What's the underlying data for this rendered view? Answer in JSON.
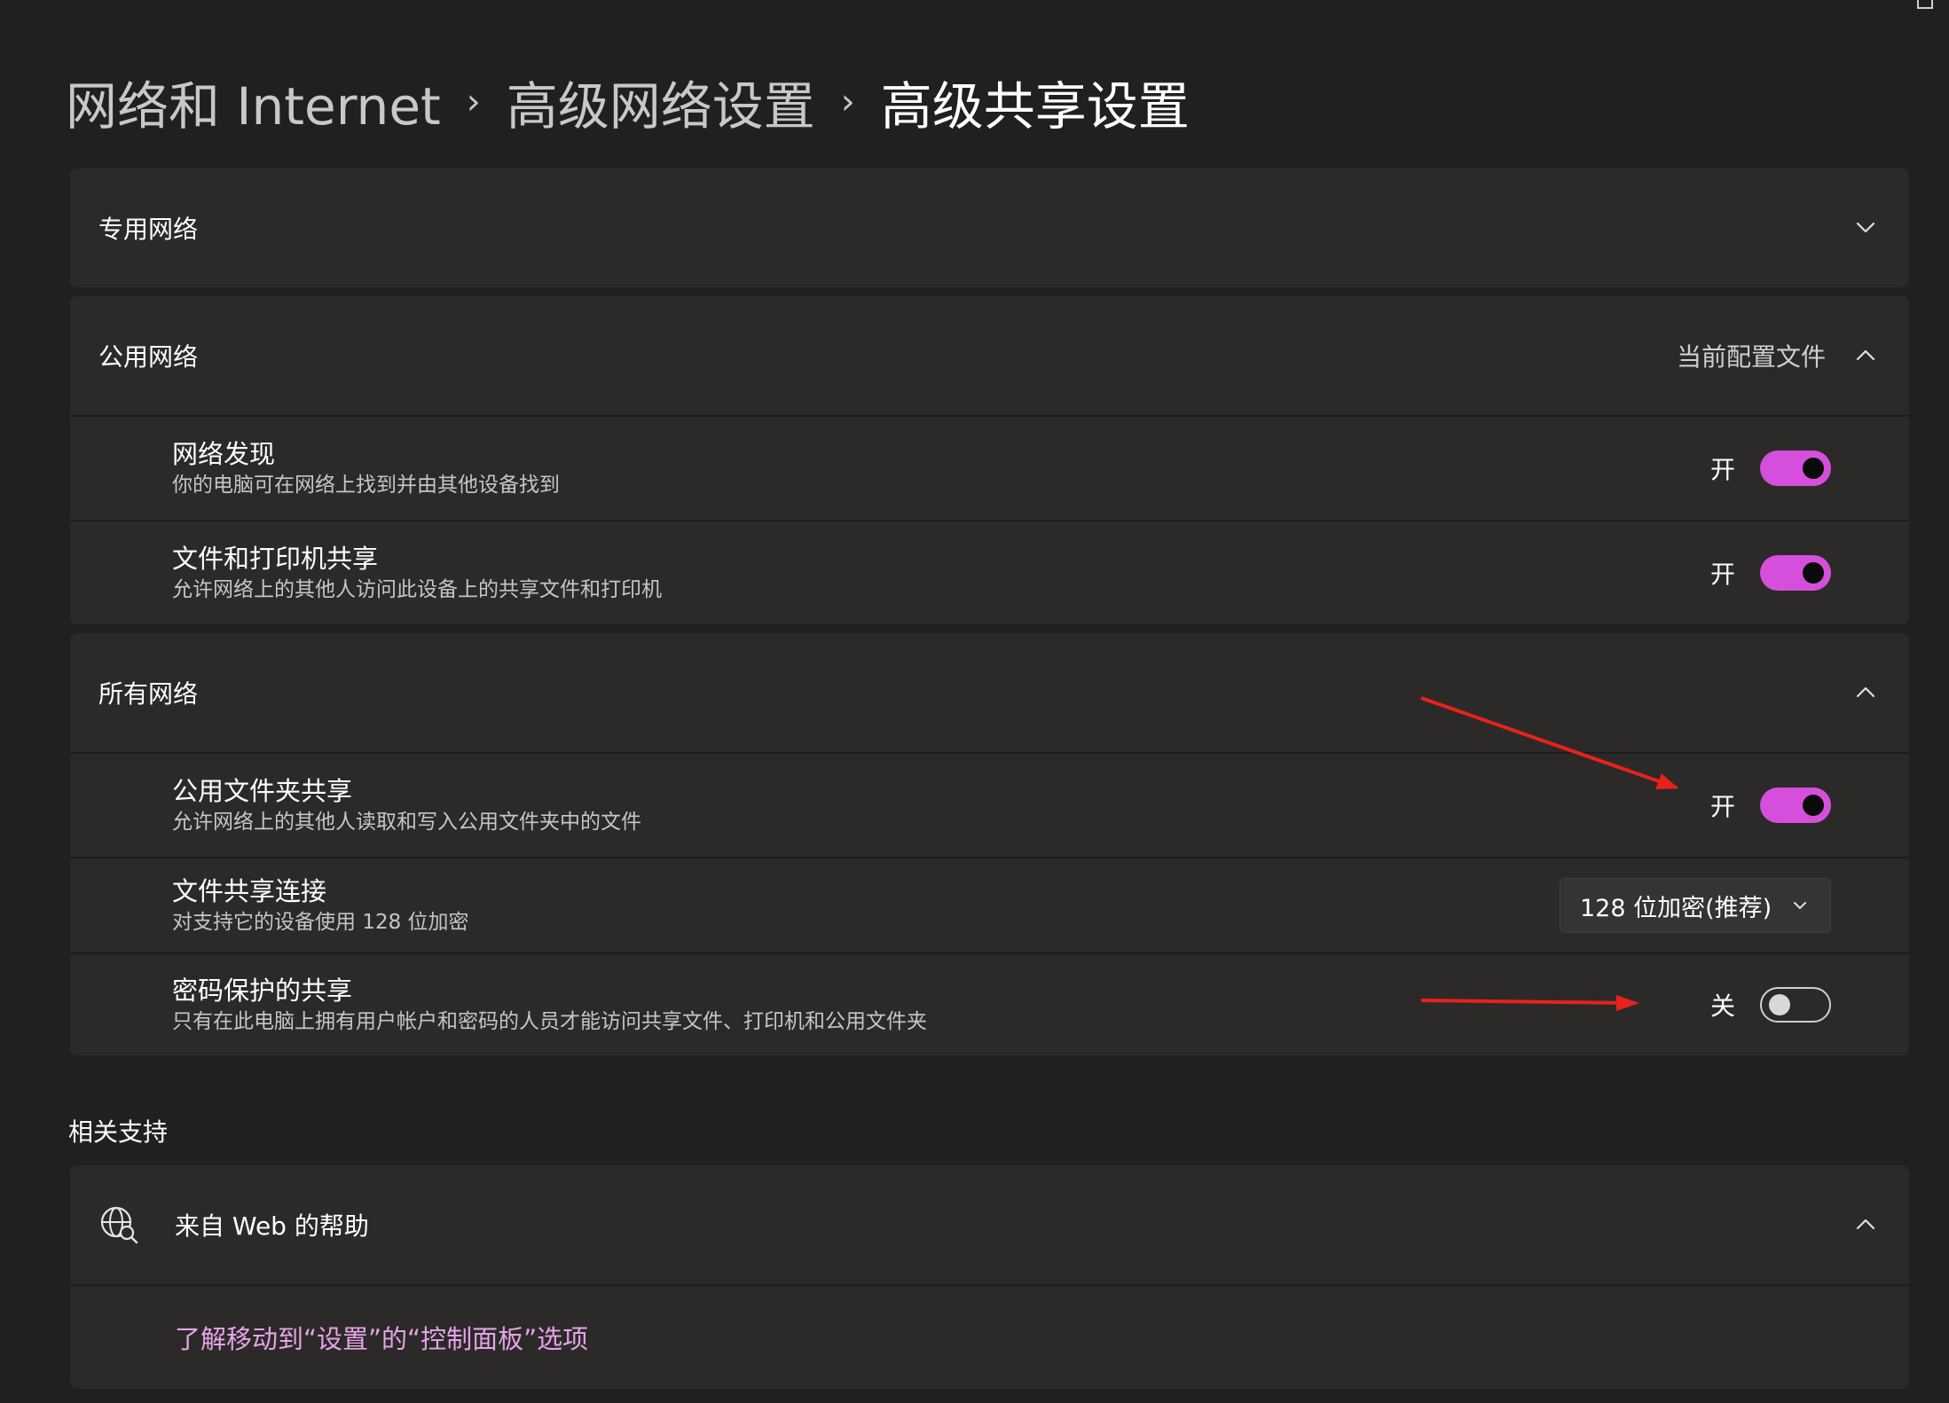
{
  "breadcrumb": {
    "items": [
      "网络和 Internet",
      "高级网络设置",
      "高级共享设置"
    ],
    "separator": "›"
  },
  "private_network": {
    "title": "专用网络",
    "expanded": false
  },
  "public_network": {
    "title": "公用网络",
    "tag": "当前配置文件",
    "expanded": true,
    "rows": [
      {
        "title": "网络发现",
        "description": "你的电脑可在网络上找到并由其他设备找到",
        "state_label": "开",
        "on": true
      },
      {
        "title": "文件和打印机共享",
        "description": "允许网络上的其他人访问此设备上的共享文件和打印机",
        "state_label": "开",
        "on": true
      }
    ]
  },
  "all_networks": {
    "title": "所有网络",
    "expanded": true,
    "public_folder_sharing": {
      "title": "公用文件夹共享",
      "description": "允许网络上的其他人读取和写入公用文件夹中的文件",
      "state_label": "开",
      "on": true
    },
    "file_sharing_connections": {
      "title": "文件共享连接",
      "description": "对支持它的设备使用 128 位加密",
      "selected": "128 位加密(推荐)"
    },
    "password_protected_sharing": {
      "title": "密码保护的共享",
      "description": "只有在此电脑上拥有用户帐户和密码的人员才能访问共享文件、打印机和公用文件夹",
      "state_label": "关",
      "on": false
    }
  },
  "related_support": {
    "label": "相关支持",
    "help_title": "来自 Web 的帮助",
    "expanded": true,
    "link": "了解移动到“设置”的“控制面板”选项"
  },
  "colors": {
    "background": "#22201e",
    "card": "#2b2a28",
    "accent": "#d64fdc",
    "link": "#e6a3e8",
    "annotation_arrow": "#e8221a"
  }
}
